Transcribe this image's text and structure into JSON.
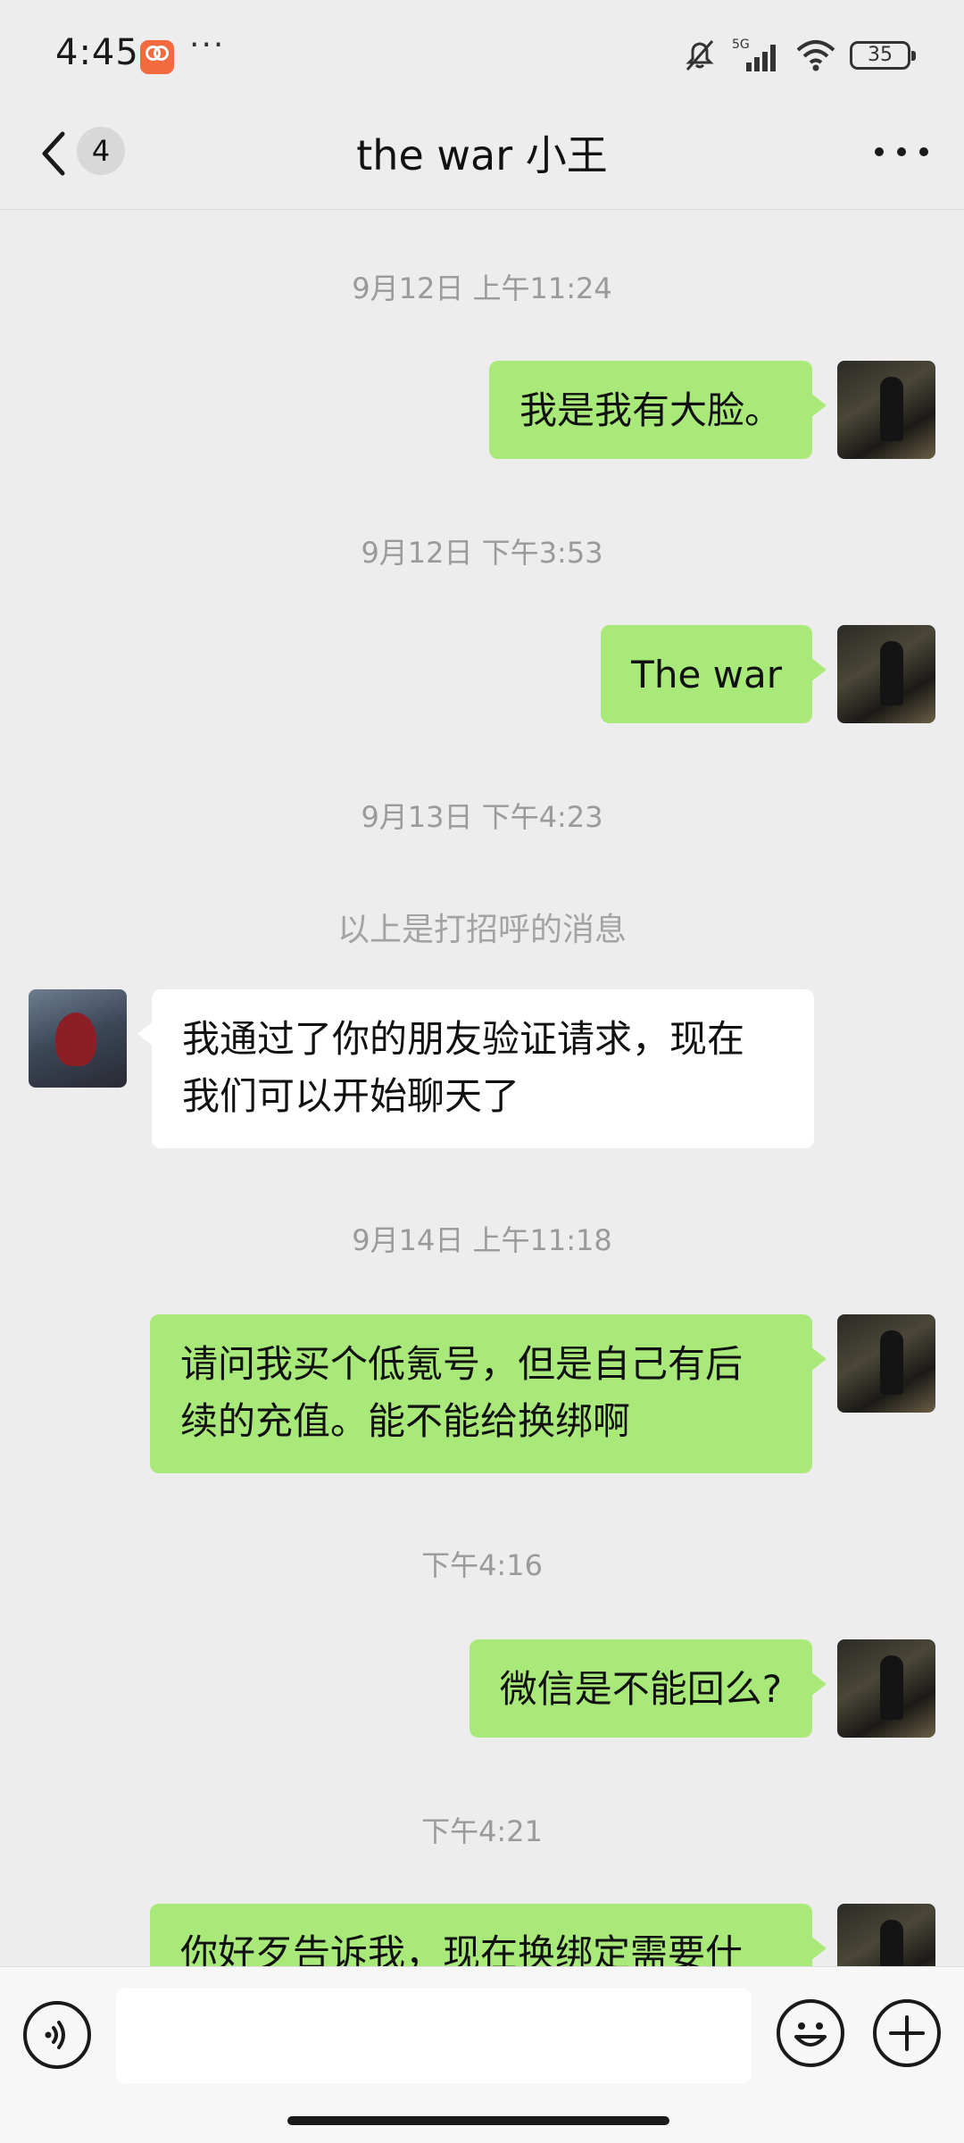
{
  "status_bar": {
    "time": "4:45",
    "more": "···",
    "network": "5G",
    "battery": "35"
  },
  "nav": {
    "unread_count": "4",
    "title": "the war 小王"
  },
  "messages": {
    "ts1": "9月12日 上午11:24",
    "m1": "我是我有大脸。",
    "ts2": "9月12日 下午3:53",
    "m2": "The war",
    "ts3": "9月13日 下午4:23",
    "sys_note": "以上是打招呼的消息",
    "m3_line1": "我通过了你的朋友验证请求，现在",
    "m3_line2": "我们可以开始聊天了",
    "ts4": "9月14日 上午11:18",
    "m4_line1": "请问我买个低氪号，但是自己有后",
    "m4_line2": "续的充值。能不能给换绑啊",
    "ts5": "下午4:16",
    "m5": "微信是不能回么?",
    "ts6": "下午4:21",
    "m6": "你好歹告诉我，现在换绑定需要什"
  },
  "input": {
    "value": ""
  },
  "colors": {
    "self_bubble": "#a9e97a",
    "other_bubble": "#ffffff",
    "background": "#ededed"
  }
}
